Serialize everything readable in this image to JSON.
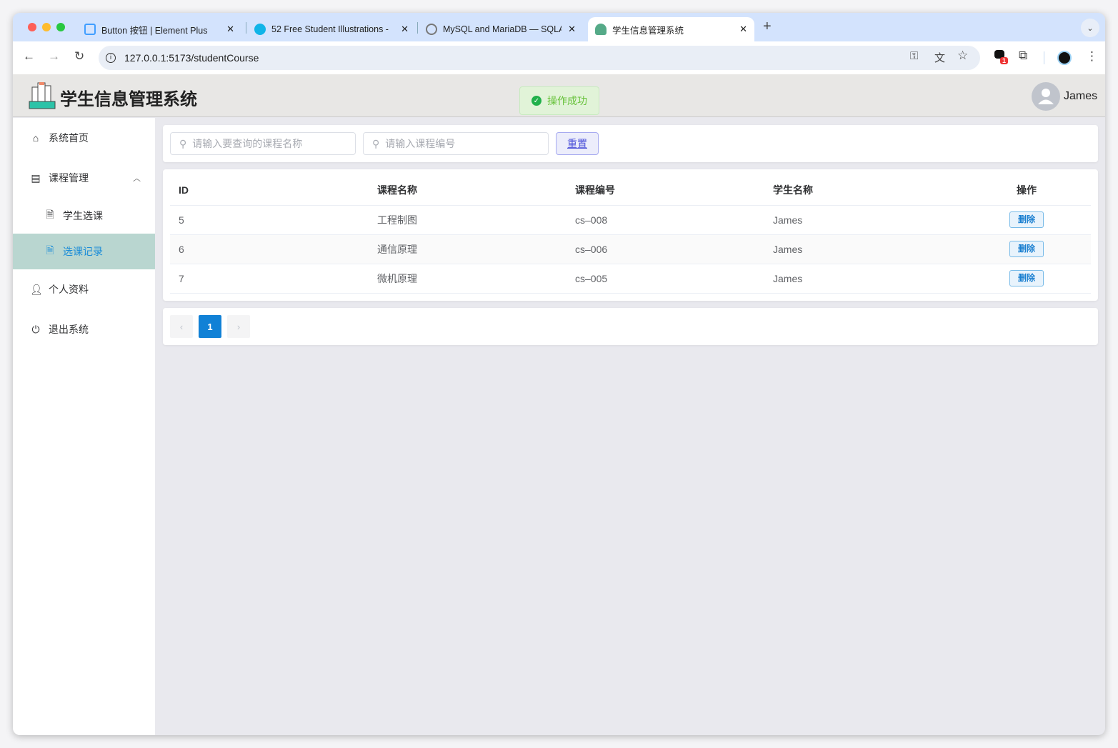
{
  "browser": {
    "tabs": [
      {
        "title": "Button 按钮 | Element Plus"
      },
      {
        "title": "52 Free Student Illustrations -"
      },
      {
        "title": "MySQL and MariaDB — SQLA"
      },
      {
        "title": "学生信息管理系统"
      }
    ],
    "url": "127.0.0.1:5173/studentCourse",
    "extension_badge": "1"
  },
  "app": {
    "title": "学生信息管理系统",
    "toast": "操作成功",
    "user": "James"
  },
  "sidebar": {
    "items": [
      {
        "label": "系统首页"
      },
      {
        "label": "课程管理"
      },
      {
        "label": "学生选课"
      },
      {
        "label": "选课记录"
      },
      {
        "label": "个人资料"
      },
      {
        "label": "退出系统"
      }
    ]
  },
  "search": {
    "name_placeholder": "请输入要查询的课程名称",
    "code_placeholder": "请输入课程编号",
    "reset": "重置"
  },
  "table": {
    "headers": [
      "ID",
      "课程名称",
      "课程编号",
      "学生名称",
      "操作"
    ],
    "rows": [
      {
        "id": "5",
        "name": "工程制图",
        "code": "cs–008",
        "student": "James",
        "action": "删除"
      },
      {
        "id": "6",
        "name": "通信原理",
        "code": "cs–006",
        "student": "James",
        "action": "删除"
      },
      {
        "id": "7",
        "name": "微机原理",
        "code": "cs–005",
        "student": "James",
        "action": "删除"
      }
    ]
  },
  "pagination": {
    "prev": "‹",
    "current": "1",
    "next": "›"
  }
}
